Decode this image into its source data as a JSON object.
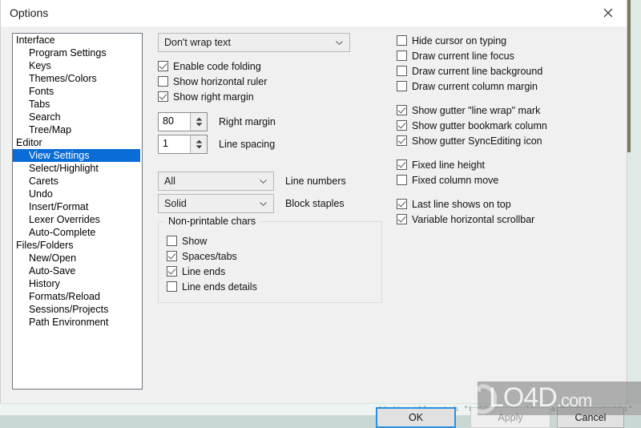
{
  "window": {
    "title": "Options",
    "close_icon": "close-icon"
  },
  "tree": {
    "items": [
      {
        "label": "Interface",
        "level": 0,
        "selected": false
      },
      {
        "label": "Program Settings",
        "level": 1,
        "selected": false
      },
      {
        "label": "Keys",
        "level": 1,
        "selected": false
      },
      {
        "label": "Themes/Colors",
        "level": 1,
        "selected": false
      },
      {
        "label": "Fonts",
        "level": 1,
        "selected": false
      },
      {
        "label": "Tabs",
        "level": 1,
        "selected": false
      },
      {
        "label": "Search",
        "level": 1,
        "selected": false
      },
      {
        "label": "Tree/Map",
        "level": 1,
        "selected": false
      },
      {
        "label": "Editor",
        "level": 0,
        "selected": false
      },
      {
        "label": "View Settings",
        "level": 1,
        "selected": true
      },
      {
        "label": "Select/Highlight",
        "level": 1,
        "selected": false
      },
      {
        "label": "Carets",
        "level": 1,
        "selected": false
      },
      {
        "label": "Undo",
        "level": 1,
        "selected": false
      },
      {
        "label": "Insert/Format",
        "level": 1,
        "selected": false
      },
      {
        "label": "Lexer Overrides",
        "level": 1,
        "selected": false
      },
      {
        "label": "Auto-Complete",
        "level": 1,
        "selected": false
      },
      {
        "label": "Files/Folders",
        "level": 0,
        "selected": false
      },
      {
        "label": "New/Open",
        "level": 1,
        "selected": false
      },
      {
        "label": "Auto-Save",
        "level": 1,
        "selected": false
      },
      {
        "label": "History",
        "level": 1,
        "selected": false
      },
      {
        "label": "Formats/Reload",
        "level": 1,
        "selected": false
      },
      {
        "label": "Sessions/Projects",
        "level": 1,
        "selected": false
      },
      {
        "label": "Path Environment",
        "level": 1,
        "selected": false
      }
    ]
  },
  "middle": {
    "wrap_combo": {
      "value": "Don't wrap text"
    },
    "checkboxes": [
      {
        "label": "Enable code folding",
        "checked": true
      },
      {
        "label": "Show horizontal ruler",
        "checked": false
      },
      {
        "label": "Show right margin",
        "checked": true
      }
    ],
    "spinners": [
      {
        "value": "80",
        "caption": "Right margin"
      },
      {
        "value": "1",
        "caption": "Line spacing"
      }
    ],
    "combos": [
      {
        "value": "All",
        "caption": "Line numbers"
      },
      {
        "value": "Solid",
        "caption": "Block staples"
      }
    ],
    "nonprintable_group": {
      "title": "Non-printable chars",
      "checkboxes": [
        {
          "label": "Show",
          "checked": false
        },
        {
          "label": "Spaces/tabs",
          "checked": true
        },
        {
          "label": "Line ends",
          "checked": true
        },
        {
          "label": "Line ends details",
          "checked": false
        }
      ]
    }
  },
  "right": {
    "group1": [
      {
        "label": "Hide cursor on typing",
        "checked": false
      },
      {
        "label": "Draw current line focus",
        "checked": false
      },
      {
        "label": "Draw current line background",
        "checked": false
      },
      {
        "label": "Draw current column margin",
        "checked": false
      }
    ],
    "group2": [
      {
        "label": "Show gutter \"line wrap\" mark",
        "checked": true
      },
      {
        "label": "Show gutter bookmark column",
        "checked": true
      },
      {
        "label": "Show gutter SyncEditing icon",
        "checked": true
      }
    ],
    "group3": [
      {
        "label": "Fixed line height",
        "checked": true
      },
      {
        "label": "Fixed column move",
        "checked": false
      }
    ],
    "group4": [
      {
        "label": "Last line shows on top",
        "checked": true
      },
      {
        "label": "Variable horizontal scrollbar",
        "checked": true
      }
    ]
  },
  "footer": {
    "ok": "OK",
    "apply": "Apply",
    "cancel": "Cancel"
  },
  "watermark": {
    "text": "LO4D",
    "suffix": ".com"
  },
  "backdrop": {
    "code_line": "// it will match \"hello\", \"hello_man\", \"aaaahello\""
  },
  "colors": {
    "selection": "#0a6cd6",
    "dialog_bg": "#f0f0f0",
    "focus_border": "#2b90e0"
  }
}
